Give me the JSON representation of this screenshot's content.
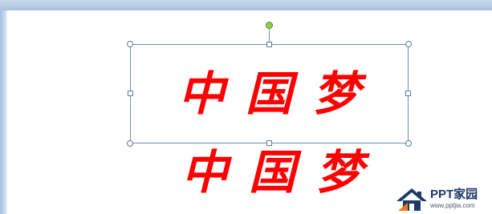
{
  "slide": {
    "text_main": "中国梦",
    "text_copy": "中国梦",
    "text_color": "#ff0000"
  },
  "selection": {
    "border_color": "#6e8fb3",
    "rotate_handle_color": "#8fd14f"
  },
  "watermark": {
    "brand": "PPT家园",
    "url": "www.pptjia.com",
    "icon": "house-logo-icon"
  }
}
